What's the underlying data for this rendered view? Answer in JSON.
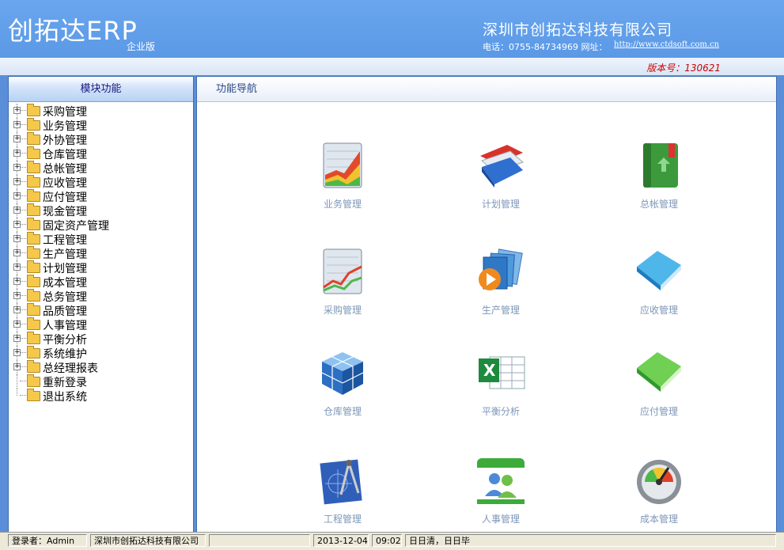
{
  "header": {
    "app_title": "创拓达ERP",
    "edition": "企业版",
    "company": "深圳市创拓达科技有限公司",
    "contact": "电话：0755-84734969 网址：",
    "url": "http://www.ctdsoft.com.cn",
    "version": "版本号：130621"
  },
  "left_panel": {
    "title": "模块功能",
    "items": [
      {
        "label": "采购管理"
      },
      {
        "label": "业务管理"
      },
      {
        "label": "外协管理"
      },
      {
        "label": "仓库管理"
      },
      {
        "label": "总帐管理"
      },
      {
        "label": "应收管理"
      },
      {
        "label": "应付管理"
      },
      {
        "label": "现金管理"
      },
      {
        "label": "固定资产管理"
      },
      {
        "label": "工程管理"
      },
      {
        "label": "生产管理"
      },
      {
        "label": "计划管理"
      },
      {
        "label": "成本管理"
      },
      {
        "label": "总务管理"
      },
      {
        "label": "品质管理"
      },
      {
        "label": "人事管理"
      },
      {
        "label": "平衡分析"
      },
      {
        "label": "系统维护"
      },
      {
        "label": "总经理报表"
      },
      {
        "label": "重新登录"
      },
      {
        "label": "退出系统"
      }
    ]
  },
  "right_panel": {
    "title": "功能导航",
    "tiles": [
      {
        "label": "业务管理",
        "icon": "chart-growth-icon"
      },
      {
        "label": "计划管理",
        "icon": "folders-icon"
      },
      {
        "label": "总帐管理",
        "icon": "green-book-icon"
      },
      {
        "label": "采购管理",
        "icon": "chart-line-icon"
      },
      {
        "label": "生产管理",
        "icon": "media-cards-icon"
      },
      {
        "label": "应收管理",
        "icon": "blue-book-icon"
      },
      {
        "label": "仓库管理",
        "icon": "cube-puzzle-icon"
      },
      {
        "label": "平衡分析",
        "icon": "excel-icon"
      },
      {
        "label": "应付管理",
        "icon": "green-notebook-icon"
      },
      {
        "label": "工程管理",
        "icon": "drafting-compass-icon"
      },
      {
        "label": "人事管理",
        "icon": "users-icon"
      },
      {
        "label": "成本管理",
        "icon": "gauge-icon"
      }
    ]
  },
  "status": {
    "user": "登录者：Admin",
    "company": "深圳市创拓达科技有限公司",
    "date": "2013-12-04",
    "time": "09:02",
    "motto": "日日清，日日毕"
  }
}
